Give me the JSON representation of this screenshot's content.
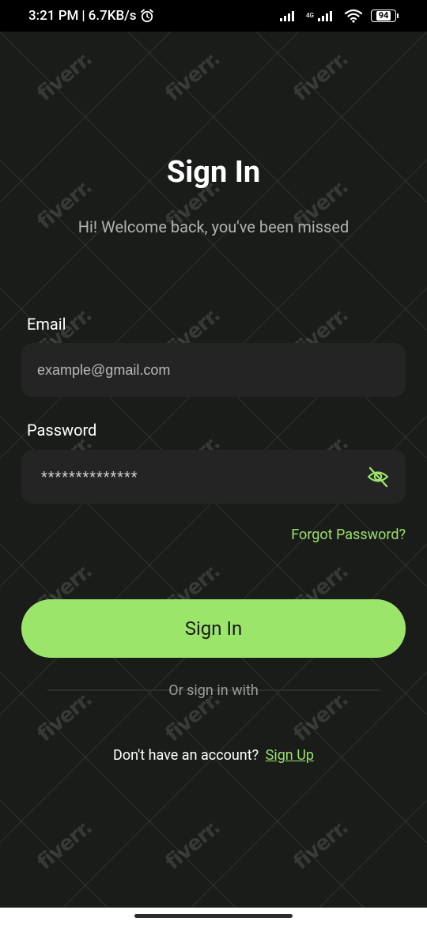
{
  "status_bar": {
    "time": "3:21 PM",
    "separator": "|",
    "net_speed": "6.7KB/s",
    "network_type": "4G",
    "battery": "94"
  },
  "watermark": "fiverr.",
  "header": {
    "title": "Sign In",
    "subtitle": "Hi! Welcome back, you've been missed"
  },
  "form": {
    "email_label": "Email",
    "email_placeholder": "example@gmail.com",
    "password_label": "Password",
    "password_value": "**************",
    "forgot_password": "Forgot Password?"
  },
  "actions": {
    "signin_button": "Sign In",
    "or_text": "Or sign in with",
    "no_account_text": "Don't have an account?",
    "signup_link": "Sign Up"
  },
  "colors": {
    "background": "#1a1c1a",
    "accent": "#9ce56b",
    "input_bg": "#232423"
  },
  "icons": {
    "alarm": "alarm-icon",
    "signal": "signal-icon",
    "wifi": "wifi-icon",
    "battery": "battery-icon",
    "eye_off": "eye-off-icon"
  }
}
